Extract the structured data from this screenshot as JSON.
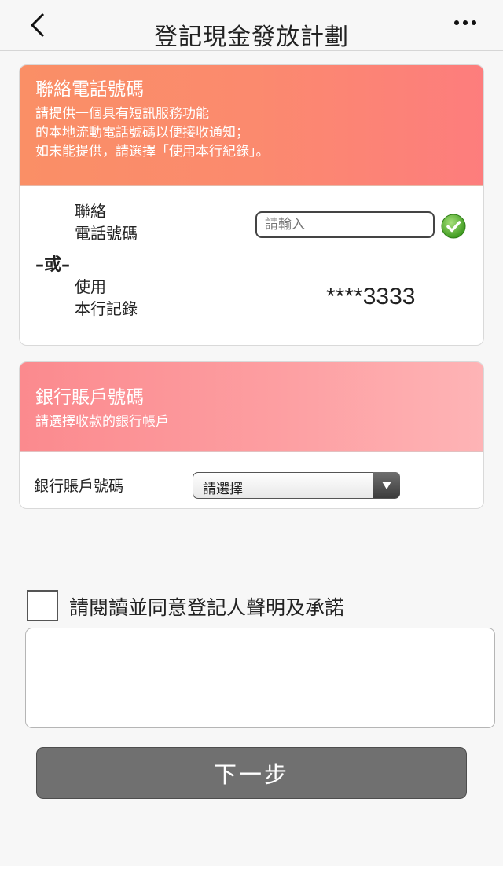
{
  "header": {
    "title": "登記現金發放計劃",
    "back_icon": "chevron-left-icon",
    "more_icon": "more-dots-icon"
  },
  "contact_section": {
    "title": "聯絡電話號碼",
    "description_lines": [
      "請提供一個具有短訊服務功能",
      "的本地流動電話號碼以便接收通知；",
      "如未能提供，請選擇「使用本行紀錄」。"
    ],
    "phone_label_line1": "聯絡",
    "phone_label_line2": "電話號碼",
    "phone_input": {
      "value": "",
      "placeholder": "請輸入"
    },
    "status_icon": "check-circle-icon",
    "or_label": "–或–",
    "record_label_line1": "使用",
    "record_label_line2": "本行記錄",
    "record_value": "****3333"
  },
  "bank_section": {
    "title": "銀行賬戶號碼",
    "description": "請選擇收款的銀行帳戶",
    "field_label": "銀行賬戶號碼",
    "select_value": "請選擇"
  },
  "agreement": {
    "label": "請閱讀並同意登記人聲明及承諾",
    "checked": false
  },
  "next_button": {
    "label": "下一步"
  },
  "colors": {
    "contact_header_gradient": [
      "#fa8f66",
      "#fd7d7d"
    ],
    "bank_header_gradient": [
      "#fb8a8e",
      "#feb4b6"
    ],
    "next_button": "#707070",
    "check_green": "#5cb82e"
  }
}
